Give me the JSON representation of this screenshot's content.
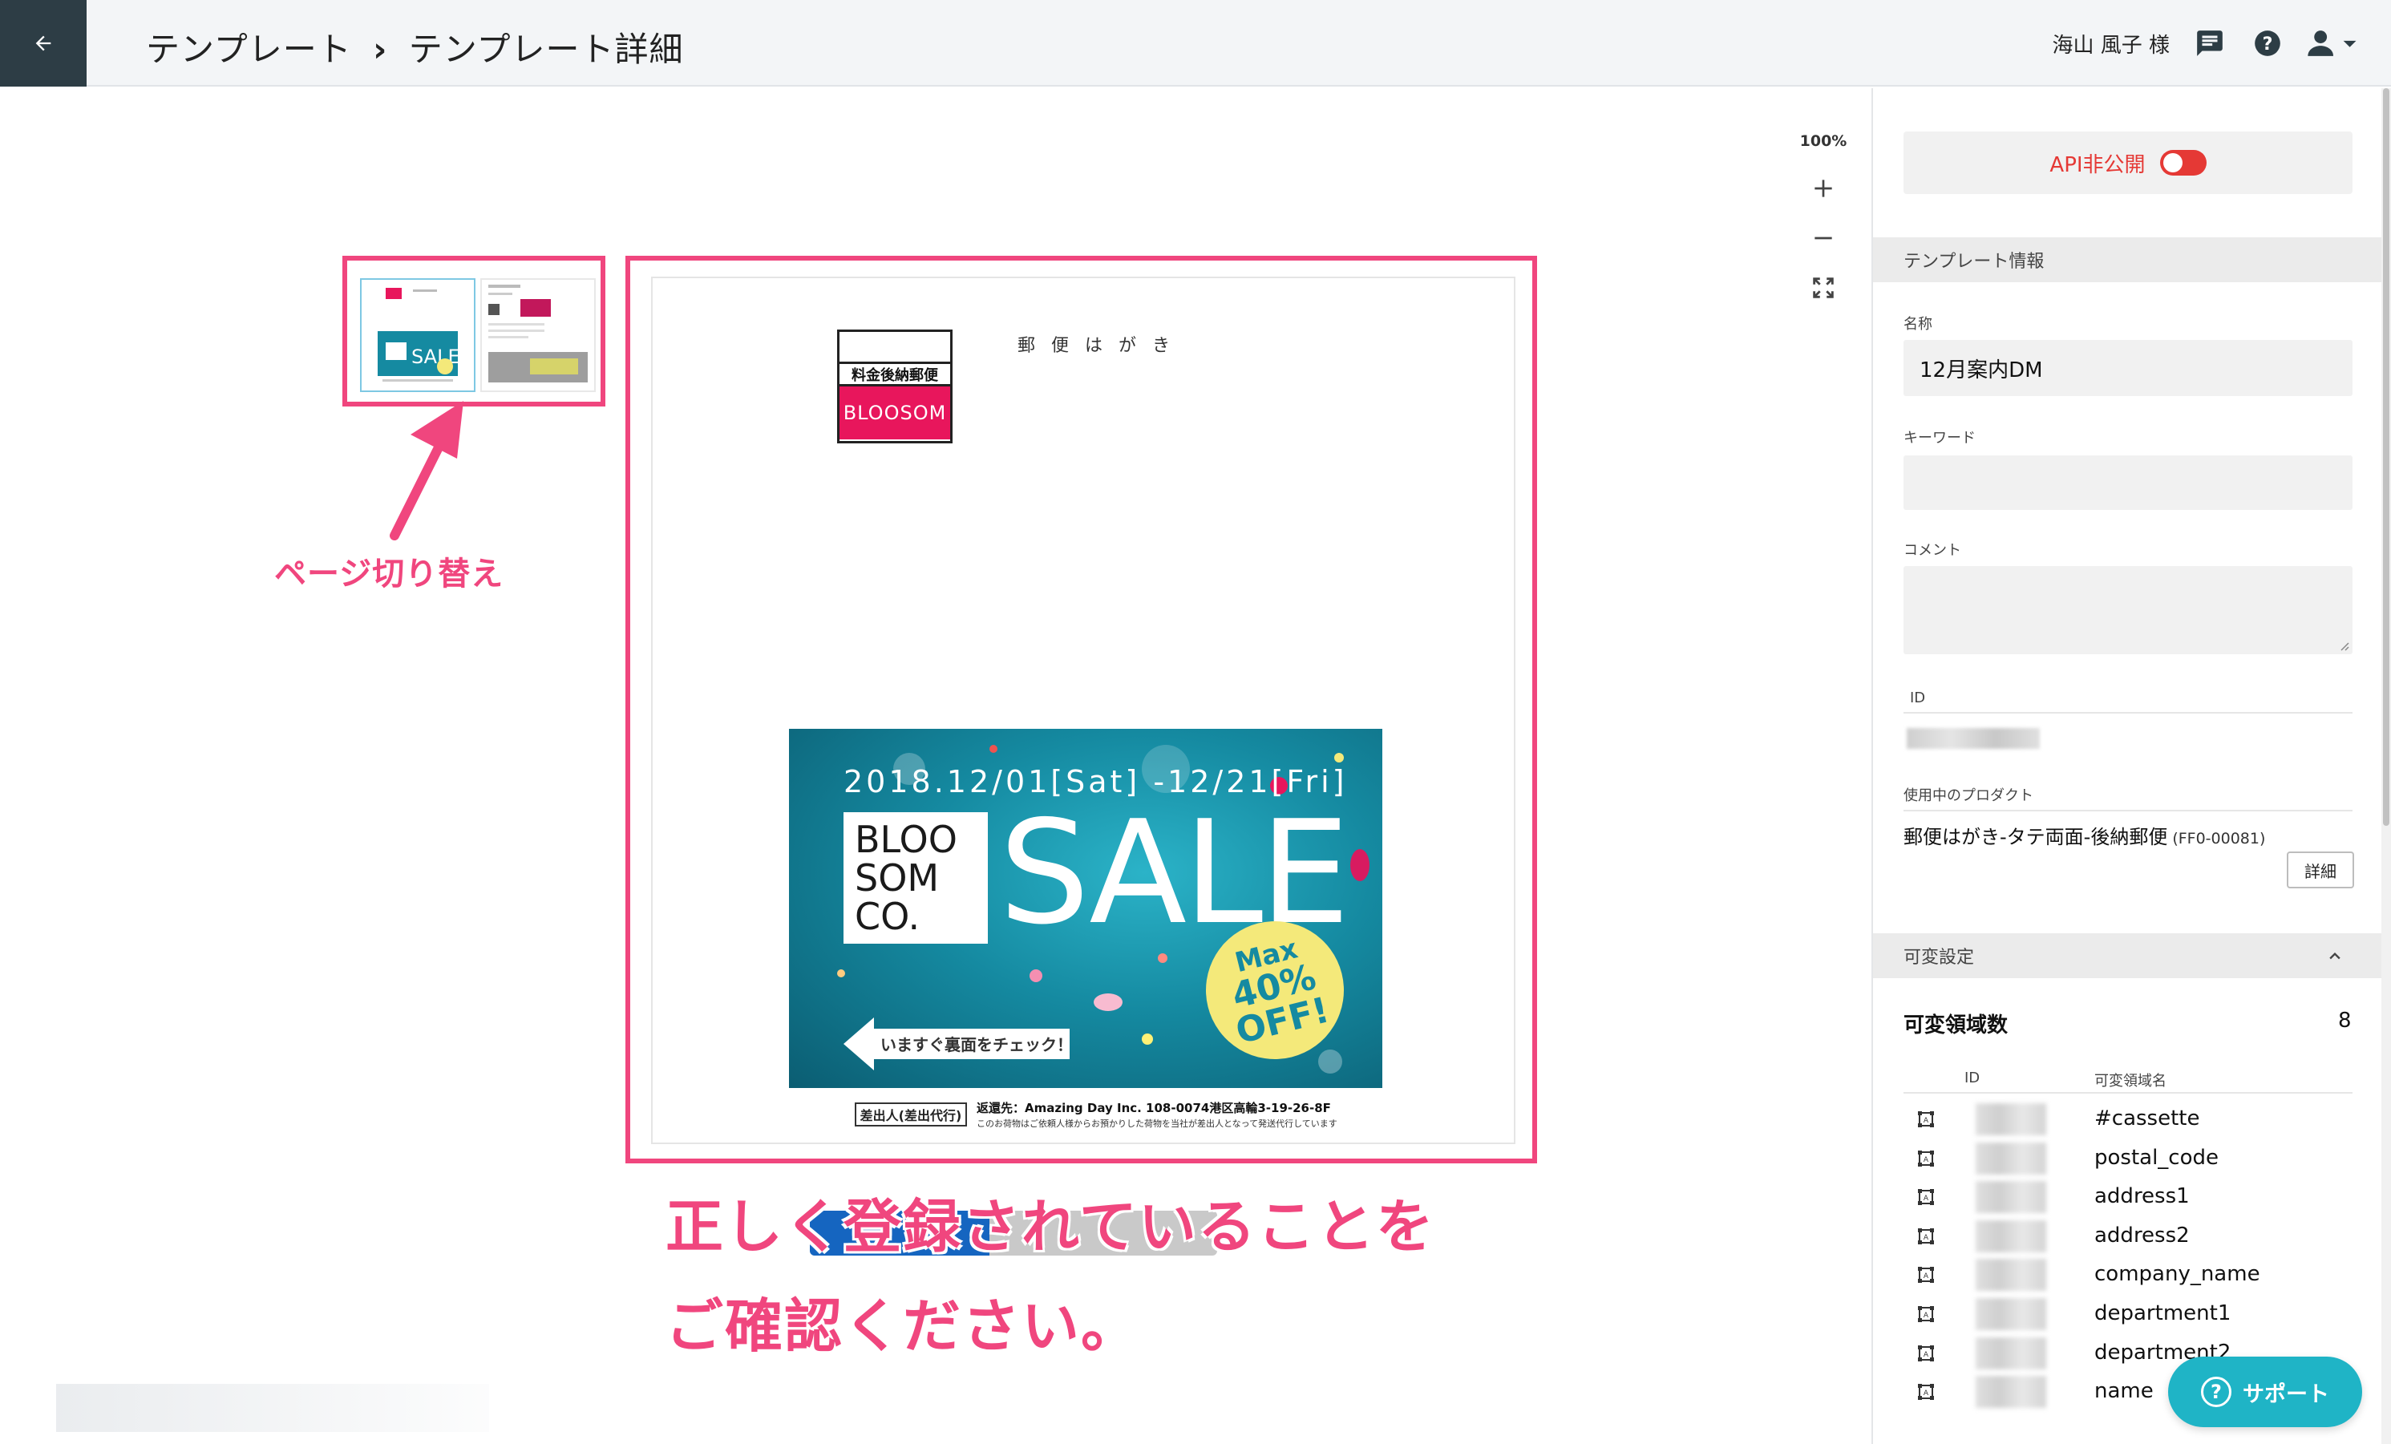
{
  "header": {
    "breadcrumb_parent": "テンプレート",
    "breadcrumb_sep": "›",
    "breadcrumb_current": "テンプレート詳細",
    "user_name": "海山 風子 様"
  },
  "viewer": {
    "zoom_level": "100%"
  },
  "postcard": {
    "postcard_word": "郵便はがき",
    "postmark_label": "料金後納郵便",
    "postmark_brand": "BLOOSOM",
    "banner_date": "2018.12/01[Sat] -12/21[Fri]",
    "banner_logo_line1": "BLOO",
    "banner_logo_line2": "SOM",
    "banner_logo_line3": "CO.",
    "banner_sale": "SALE",
    "badge_line1": "Max",
    "badge_line2": "40%",
    "badge_line3": "OFF!",
    "cta": "いますぐ裏面をチェック！",
    "sender_box": "差出人(差出代行)",
    "sender_line1": "返還先：Amazing Day Inc. 108-0074港区高輪3-19-26-8F",
    "sender_line2": "このお荷物はご依頼人様からお預かりした荷物を当社が差出人となって発送代行しています"
  },
  "annotations": {
    "page_switch": "ページ切り替え",
    "confirm_line1": "正しく登録されていることを",
    "confirm_line2": "ご確認ください。"
  },
  "panel": {
    "api_label": "API非公開",
    "section_template_info": "テンプレート情報",
    "name_label": "名称",
    "name_value": "12月案内DM",
    "keyword_label": "キーワード",
    "keyword_value": "",
    "comment_label": "コメント",
    "comment_value": "",
    "id_label": "ID",
    "product_label": "使用中のプロダクト",
    "product_name": "郵便はがき-タテ両面-後納郵便",
    "product_code": "(FF0-00081)",
    "detail_button": "詳細",
    "section_variable": "可変設定",
    "var_count_label": "可変領域数",
    "var_count": "8",
    "col_id": "ID",
    "col_name": "可変領域名",
    "variables": [
      "#cassette",
      "postal_code",
      "address1",
      "address2",
      "company_name",
      "department1",
      "department2",
      "name"
    ]
  },
  "support": {
    "label": "サポート"
  },
  "colors": {
    "accent_pink": "#f0467e",
    "header_dark": "#2d3d45",
    "api_red": "#e53935",
    "support_teal": "#1fb4c6"
  }
}
